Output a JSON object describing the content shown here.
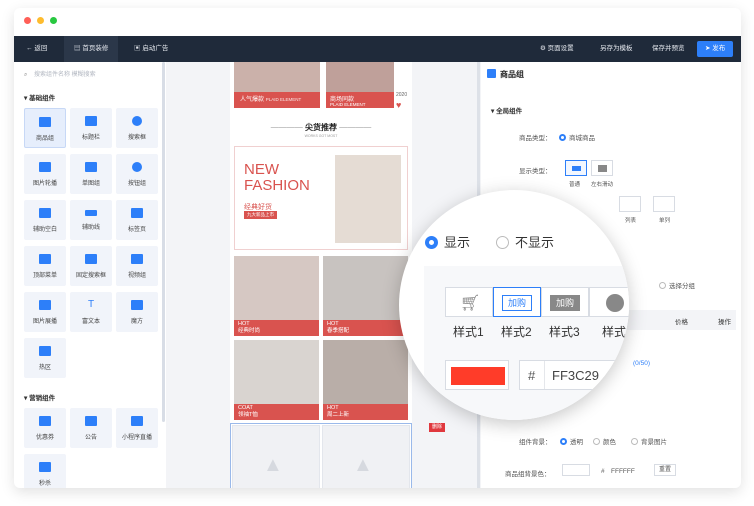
{
  "topbar": {
    "back": "返回",
    "home_decor": "首页装修",
    "launch_ad": "启动广告",
    "page_settings": "页面设置",
    "save_template": "另存为模板",
    "save_preview": "保存并预览",
    "publish": "发布"
  },
  "left": {
    "search_placeholder": "搜索组件名称 模糊搜索",
    "basic_title": "基础组件",
    "basic_items": [
      "商品组",
      "标题栏",
      "搜索框",
      "图片轮播",
      "单图组",
      "按钮组",
      "辅助空白",
      "辅助线",
      "标签页",
      "顶部菜单",
      "固定搜索框",
      "视频组",
      "图片展播",
      "富文本",
      "魔方",
      "热区"
    ],
    "marketing_title": "营销组件",
    "marketing_items": [
      "优惠券",
      "公告",
      "小程序直播",
      "秒杀"
    ]
  },
  "phone": {
    "banner_left": "人气爆款",
    "banner_left_en": "PLAID ELEMENT",
    "banner_right": "商场同款",
    "banner_right_en": "PLAID ELEMENT",
    "year": "2020",
    "section_title": "尖货推荐",
    "section_sub": "WORKS GOT MOST",
    "promo_line1": "NEW",
    "promo_line2": "FASHION",
    "promo_cn": "经典好货",
    "promo_tag": "九大新品上市",
    "products": [
      {
        "tag": "HOT",
        "name": "经典时尚"
      },
      {
        "tag": "HOT",
        "name": "春季搭配"
      },
      {
        "tag": "COAT",
        "name": "领袖T恤"
      },
      {
        "tag": "HOT",
        "name": "周二上新"
      }
    ],
    "delete_label": "删除"
  },
  "right": {
    "panel_title": "商品组",
    "global_title": "全局组件",
    "product_type_label": "商品类型：",
    "product_type_value": "商城商品",
    "display_type_label": "显示类型：",
    "display_types": [
      "普通",
      "左右滑动"
    ],
    "list_types": [
      "列表",
      "单列"
    ],
    "category_options": [
      "选择分组"
    ],
    "table_price": "价格",
    "table_action": "操作",
    "counter": "(0/50)",
    "bg_label": "组件背景：",
    "bg_options": [
      "透明",
      "颜色",
      "背景图片"
    ],
    "item_bg_label": "商品组背景色：",
    "item_bg_value": "FFFFFF",
    "reset": "重置"
  },
  "magnifier": {
    "show": "显示",
    "hide": "不显示",
    "btn_text_1": "加购",
    "btn_text_2": "加购",
    "styles": [
      "样式1",
      "样式2",
      "样式3",
      "样式"
    ],
    "hash": "#",
    "color_value": "FF3C29",
    "color": "#ff3c29"
  },
  "colors": {
    "accent": "#2d7ff9",
    "dark": "#1f2a3a",
    "red": "#d9534f"
  }
}
